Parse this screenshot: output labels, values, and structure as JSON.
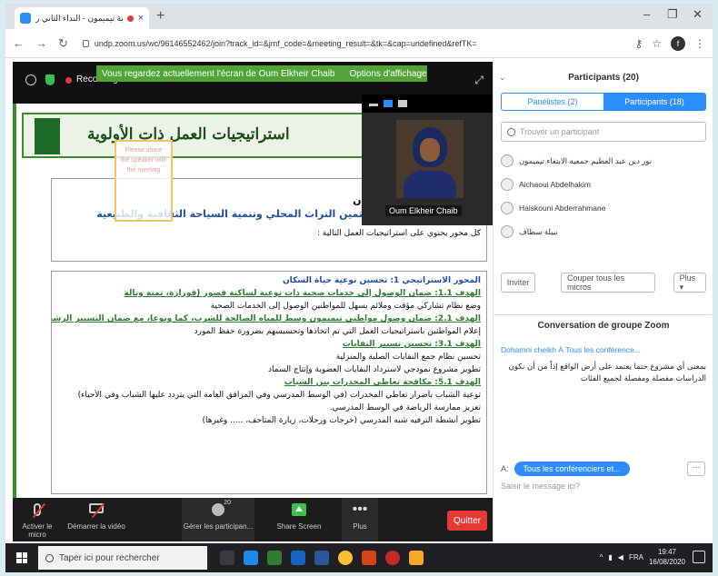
{
  "browser": {
    "tab_title": "نادية تيميمون - النداء الثاني ر...",
    "url": "undp.zoom.us/wc/96146552462/join?track_id=&jmf_code=&meeting_result=&tk=&cap=undefined&refTK=",
    "profile_initial": "f"
  },
  "meeting": {
    "recording_label": "Recording",
    "share_banner": "Vous regardez actuellement l'écran de Oum Elkheir Chaib",
    "display_options": "Options d'affichage",
    "video_name": "Oum Elkheir Chaib"
  },
  "document": {
    "title": "استراتيجيات العمل ذات الأولوية",
    "faded_note": "Please share the speaker with the meeting",
    "box1": {
      "line1": "المحور الاستراتيجي ...",
      "line2": "تحسين نوعية حياة السكان",
      "line3": "المحور الاستراتيجي 2: تثمين التراث المحلي وتنمية السياحة الثقافية والطبيعية",
      "line4": "كل محور يحتوي على استراتيجيات العمل التالية :"
    },
    "box2": [
      {
        "text": "المحور الاستراتيجي 1: تحسين نوعية حياة السكان",
        "style": "blue"
      },
      {
        "text": "الهدف 1.1: ضمان الوصول إلى خدمات صحية ذات نوعية لساكنة قصور (قورارة، تمنة وتالة",
        "style": "green"
      },
      {
        "text": "وضع نظام تشاركي مؤقت وملائم يسهل للمواطنين الوصول إلى الخدمات الصحية",
        "style": ""
      },
      {
        "text": "الهدف 2.1: ضمان وصول مواطني تيميمون وسط للمياه الصالحة للشرب، كما ونوعا، مع ضمان التسيير الرشيد للمورد",
        "style": "green"
      },
      {
        "text": "إعلام المواطنين باستراتيجيات العمل التي تم اتخاذها وتحسيسهم بضرورة حفظ المورد",
        "style": ""
      },
      {
        "text": "الهدف 3.1: تحسين تسيير النفايات",
        "style": "green"
      },
      {
        "text": "تحسين نظام جمع النفايات الصلبة والمنزلية",
        "style": ""
      },
      {
        "text": "تطوير مشروع نموذجي لاسترداد النفايات العضوية وإنتاج السماد",
        "style": ""
      },
      {
        "text": "الهدف 5.1: مكافحة تعاطي المخدرات بين الشباب",
        "style": "green"
      },
      {
        "text": "توعية الشباب بأضرار تعاطي المخدرات (في الوسط المدرسي وفي المرافق العامة التي يتردد عليها الشباب وفي الأحياء)",
        "style": ""
      },
      {
        "text": "تعزيز ممارسة الرياضة في الوسط المدرسي.",
        "style": ""
      },
      {
        "text": "تطوير أنشطة الترفيه شبه المدرسي (خرجات ورحلات، زيارة المتاحف، ..... وغيرها)",
        "style": ""
      }
    ]
  },
  "toolbar": {
    "mute_label": "Activer le micro",
    "video_label": "Démarrer la vidéo",
    "participants_label": "Gérer les participan...",
    "participants_count": "20",
    "share_label": "Share Screen",
    "more_label": "Plus",
    "quit_label": "Quitter"
  },
  "panel": {
    "title": "Participants (20)",
    "tab_panelists": "Panélistes (2)",
    "tab_participants": "Participants (18)",
    "search_placeholder": "Trouver un participant",
    "participants": [
      "نور دين عبد العظيم جمعية الابتغاء تيميمون",
      "Aichaoui Abdelhakim",
      "Haiskouni Abderrahmane",
      "نبيلة سطاف"
    ],
    "btn_invite": "Inviter",
    "btn_mute_all": "Couper tous les micros",
    "btn_more": "Plus ▾",
    "chat_title": "Conversation de groupe Zoom",
    "chat_sender": "Dohamni cheikh À Tous les conférence...",
    "chat_message": "بمعنى أي مشروع حتما يعتمد على أرض الواقع إذاً من أن نكون الدراسات مفصلة ومفصلة لجميع الفئات",
    "to_label": "A:",
    "to_value": "Tous les conférenciers et...",
    "input_placeholder": "Saisir le message ici?"
  },
  "taskbar": {
    "search_placeholder": "Taper ici pour rechercher",
    "lang": "FRA",
    "time": "19:47",
    "date": "16/08/2020"
  }
}
